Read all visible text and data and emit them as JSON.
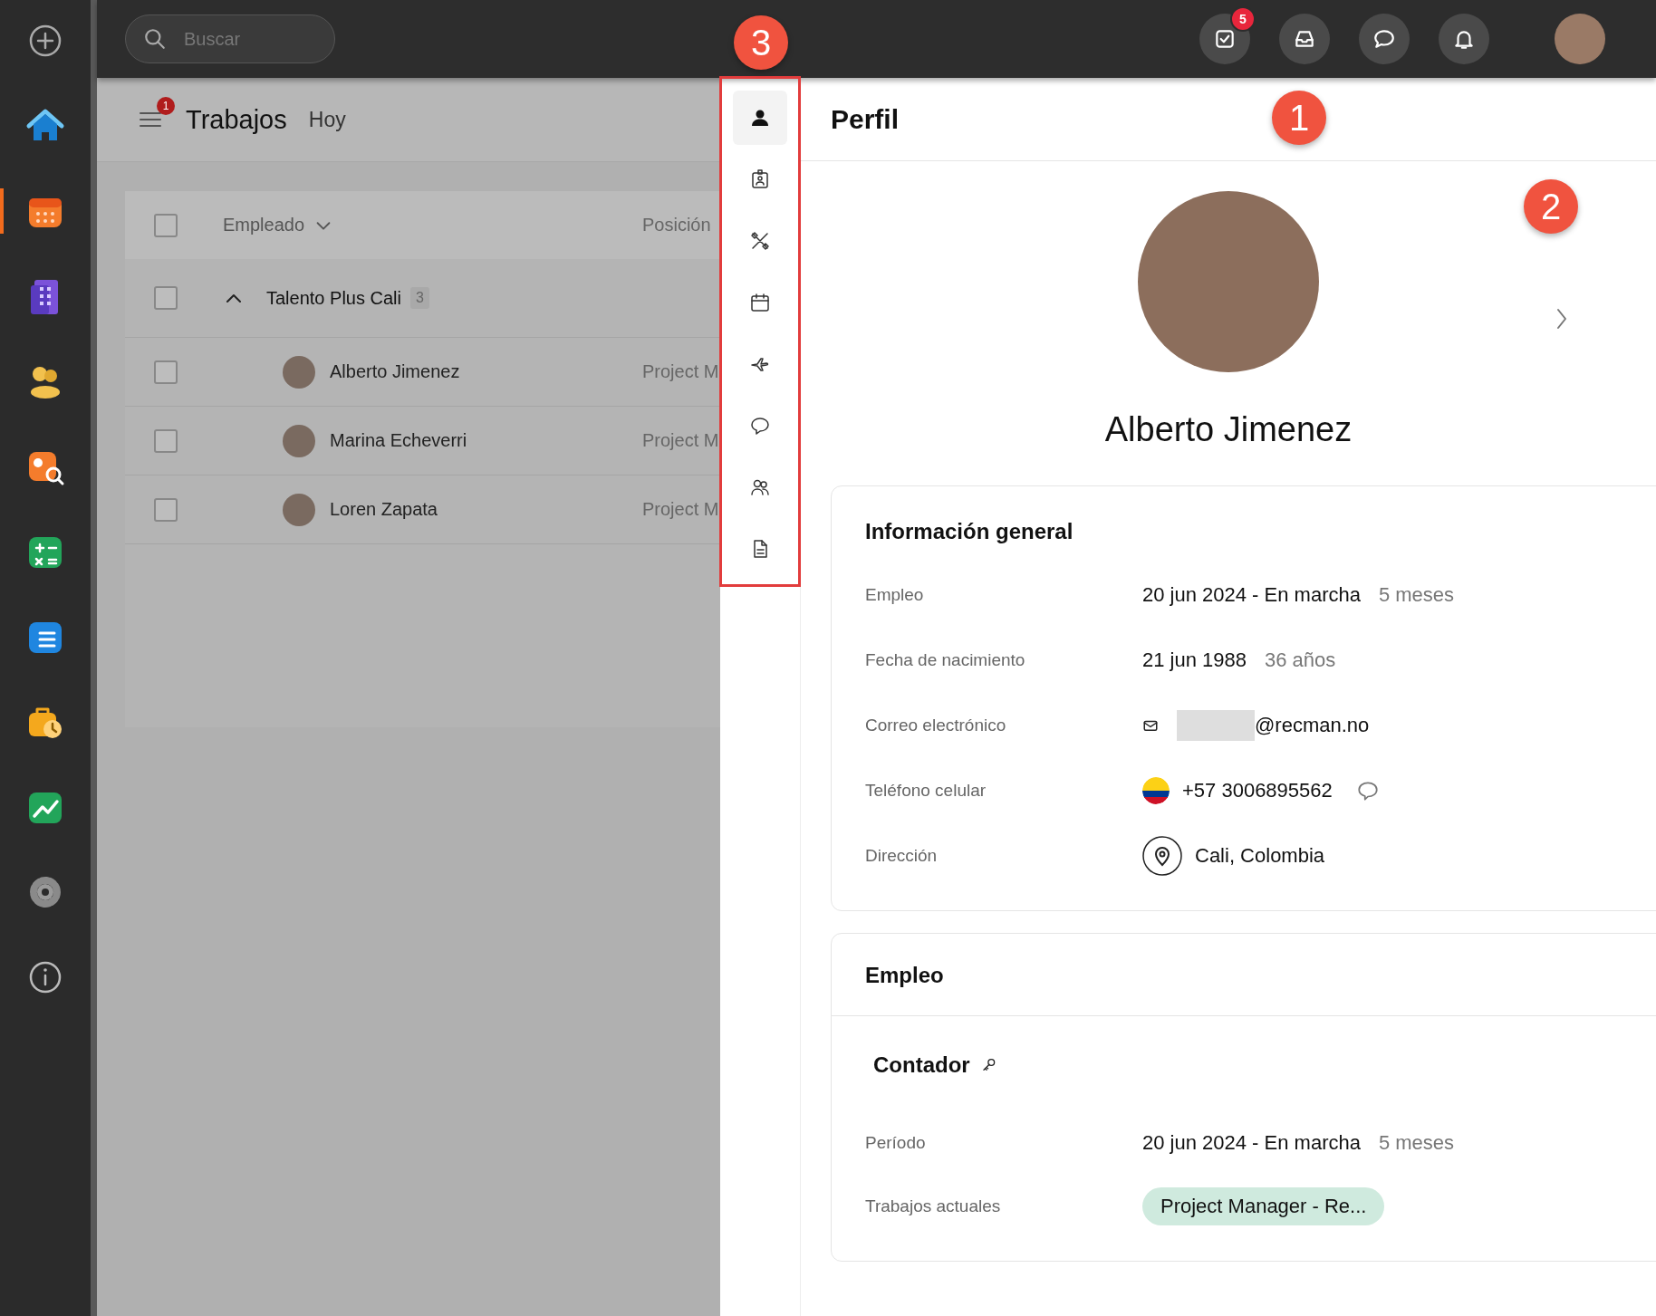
{
  "rail": {
    "items": [
      {
        "kind": "add",
        "selected": false
      },
      {
        "kind": "home",
        "selected": false
      },
      {
        "kind": "calendar",
        "selected": true
      },
      {
        "kind": "building",
        "selected": false
      },
      {
        "kind": "people",
        "selected": false
      },
      {
        "kind": "search-person",
        "selected": false
      },
      {
        "kind": "calculator",
        "selected": false
      },
      {
        "kind": "document",
        "selected": false
      },
      {
        "kind": "briefcase",
        "selected": false
      },
      {
        "kind": "chart",
        "selected": false
      },
      {
        "kind": "gear",
        "selected": false
      },
      {
        "kind": "info",
        "selected": false
      }
    ]
  },
  "topbar": {
    "search": {
      "placeholder": "Buscar"
    },
    "actions": [
      {
        "kind": "tasks",
        "badge": "5"
      },
      {
        "kind": "inbox"
      },
      {
        "kind": "chat"
      },
      {
        "kind": "bell"
      }
    ]
  },
  "list": {
    "menu_badge": "1",
    "title": "Trabajos",
    "subtitle": "Hoy",
    "header_checked": false,
    "columns": [
      "Empleado",
      "Posición"
    ],
    "group": {
      "name": "Talento Plus Cali",
      "count": "3",
      "expanded": true,
      "checked": false
    },
    "rows": [
      {
        "name": "Alberto Jimenez",
        "position": "Project M",
        "checked": false
      },
      {
        "name": "Marina Echeverri",
        "position": "Project M",
        "checked": false
      },
      {
        "name": "Loren Zapata",
        "position": "Project M",
        "checked": false
      }
    ]
  },
  "profile_tabs": [
    {
      "kind": "person",
      "selected": true
    },
    {
      "kind": "id-card",
      "selected": false
    },
    {
      "kind": "tools",
      "selected": false
    },
    {
      "kind": "calendar",
      "selected": false
    },
    {
      "kind": "plane",
      "selected": false
    },
    {
      "kind": "comment",
      "selected": false
    },
    {
      "kind": "people",
      "selected": false
    },
    {
      "kind": "file",
      "selected": false
    }
  ],
  "profile": {
    "title": "Perfil",
    "name": "Alberto Jimenez",
    "general": {
      "title": "Información general",
      "fields": [
        {
          "kind": "text",
          "label": "Empleo",
          "value": "20 jun 2024 - En marcha",
          "note": "5 meses"
        },
        {
          "kind": "text",
          "label": "Fecha de nacimiento",
          "value": "21 jun 1988",
          "note": "36 años"
        },
        {
          "kind": "email",
          "label": "Correo electrónico",
          "value": "@recman.no"
        },
        {
          "kind": "phone",
          "label": "Teléfono celular",
          "value": "+57 3006895562"
        },
        {
          "kind": "address",
          "label": "Dirección",
          "value": "Cali, Colombia"
        }
      ]
    },
    "employment": {
      "title": "Empleo",
      "role": "Contador",
      "fields": [
        {
          "kind": "text",
          "label": "Período",
          "value": "20 jun 2024 - En marcha",
          "note": "5 meses"
        },
        {
          "kind": "tag",
          "label": "Trabajos actuales",
          "value": "Project Manager - Re..."
        }
      ]
    }
  },
  "annotations": {
    "tabs": "3",
    "header": "1",
    "hero": "2"
  }
}
